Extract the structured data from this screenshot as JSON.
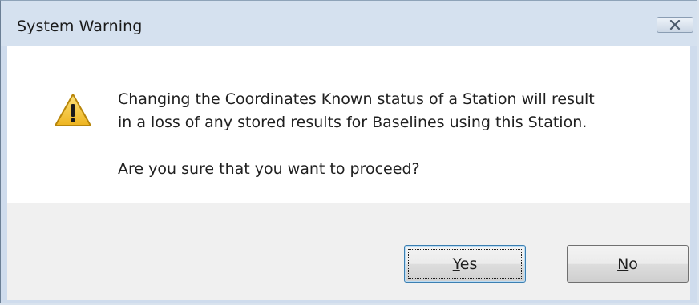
{
  "window": {
    "title": "System Warning",
    "close_icon": "close-icon"
  },
  "message": {
    "icon": "warning-icon",
    "line1": "Changing the Coordinates Known status of a Station will result",
    "line2": "in a loss of any stored results for Baselines using this Station.",
    "question": "Are you sure that you want to proceed?"
  },
  "buttons": {
    "yes": {
      "accel": "Y",
      "rest": "es"
    },
    "no": {
      "accel": "N",
      "rest": "o"
    }
  },
  "colors": {
    "warning_fill": "#f5c531",
    "warning_stroke": "#b8860b"
  }
}
